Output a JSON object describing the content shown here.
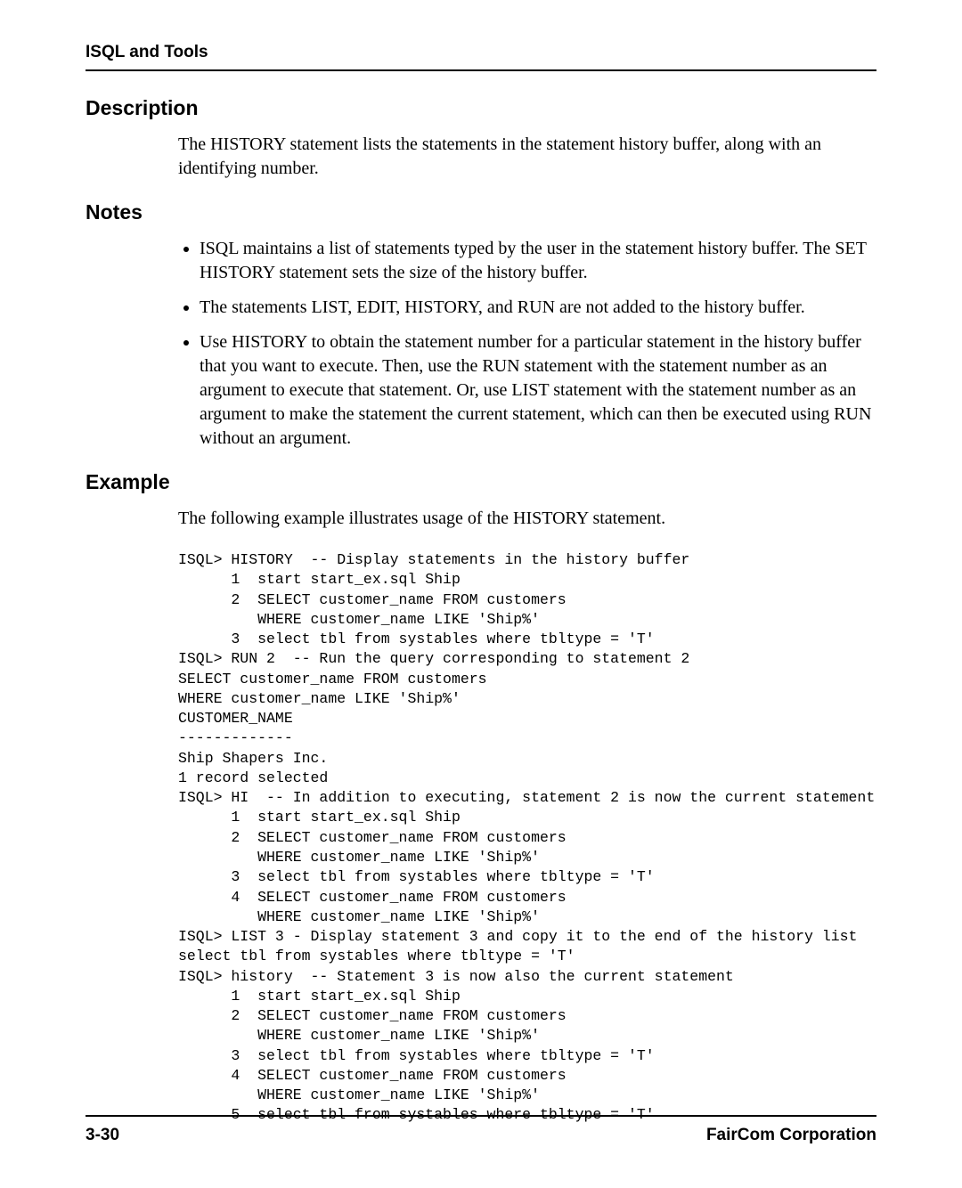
{
  "header": {
    "running_head": "ISQL and Tools"
  },
  "sections": {
    "description": {
      "heading": "Description",
      "body": "The HISTORY statement lists the statements in the statement history buffer, along with an identifying number."
    },
    "notes": {
      "heading": "Notes",
      "items": [
        "ISQL maintains a list of statements typed by the user in the statement history buffer. The SET HISTORY statement sets the size of the history buffer.",
        "The statements LIST, EDIT, HISTORY, and RUN are not added to the history buffer.",
        "Use HISTORY to obtain the statement number for a particular statement in the history buffer that you want to execute. Then, use the RUN statement with the statement number as an argument to execute that statement. Or, use LIST statement with the statement number as an argument to make the statement the current statement, which can then be executed using RUN without an argument."
      ]
    },
    "example": {
      "heading": "Example",
      "intro": "The following example illustrates usage of the HISTORY statement.",
      "code": "ISQL> HISTORY  -- Display statements in the history buffer\n      1  start start_ex.sql Ship\n      2  SELECT customer_name FROM customers\n         WHERE customer_name LIKE 'Ship%'\n      3  select tbl from systables where tbltype = 'T'\nISQL> RUN 2  -- Run the query corresponding to statement 2\nSELECT customer_name FROM customers\nWHERE customer_name LIKE 'Ship%'\nCUSTOMER_NAME\n-------------\nShip Shapers Inc.\n1 record selected\nISQL> HI  -- In addition to executing, statement 2 is now the current statement\n      1  start start_ex.sql Ship\n      2  SELECT customer_name FROM customers\n         WHERE customer_name LIKE 'Ship%'\n      3  select tbl from systables where tbltype = 'T'\n      4  SELECT customer_name FROM customers\n         WHERE customer_name LIKE 'Ship%'\nISQL> LIST 3 - Display statement 3 and copy it to the end of the history list\nselect tbl from systables where tbltype = 'T'\nISQL> history  -- Statement 3 is now also the current statement\n      1  start start_ex.sql Ship\n      2  SELECT customer_name FROM customers\n         WHERE customer_name LIKE 'Ship%'\n      3  select tbl from systables where tbltype = 'T'\n      4  SELECT customer_name FROM customers\n         WHERE customer_name LIKE 'Ship%'\n      5  select tbl from systables where tbltype = 'T'"
    }
  },
  "footer": {
    "page_number": "3-30",
    "company": "FairCom Corporation"
  }
}
